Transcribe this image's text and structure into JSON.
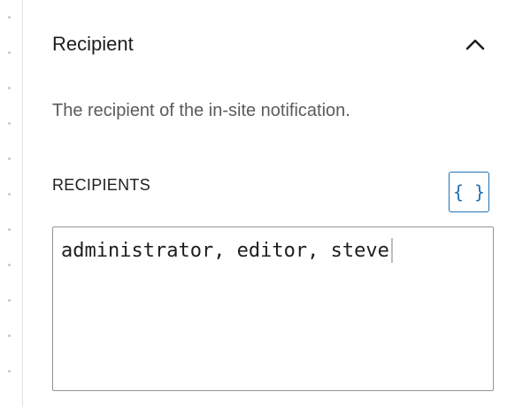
{
  "panel": {
    "title": "Recipient",
    "collapse_icon": "chevron-up-icon",
    "description": "The recipient of the in-site notification."
  },
  "recipients_field": {
    "label": "RECIPIENTS",
    "value": "administrator, editor, steve",
    "tag_button_label": "{ }",
    "tag_button_icon": "braces-icon"
  },
  "colors": {
    "accent": "#2271b1",
    "text": "#1e1e1e",
    "muted_text": "#5b5b5b",
    "border": "#949494"
  }
}
